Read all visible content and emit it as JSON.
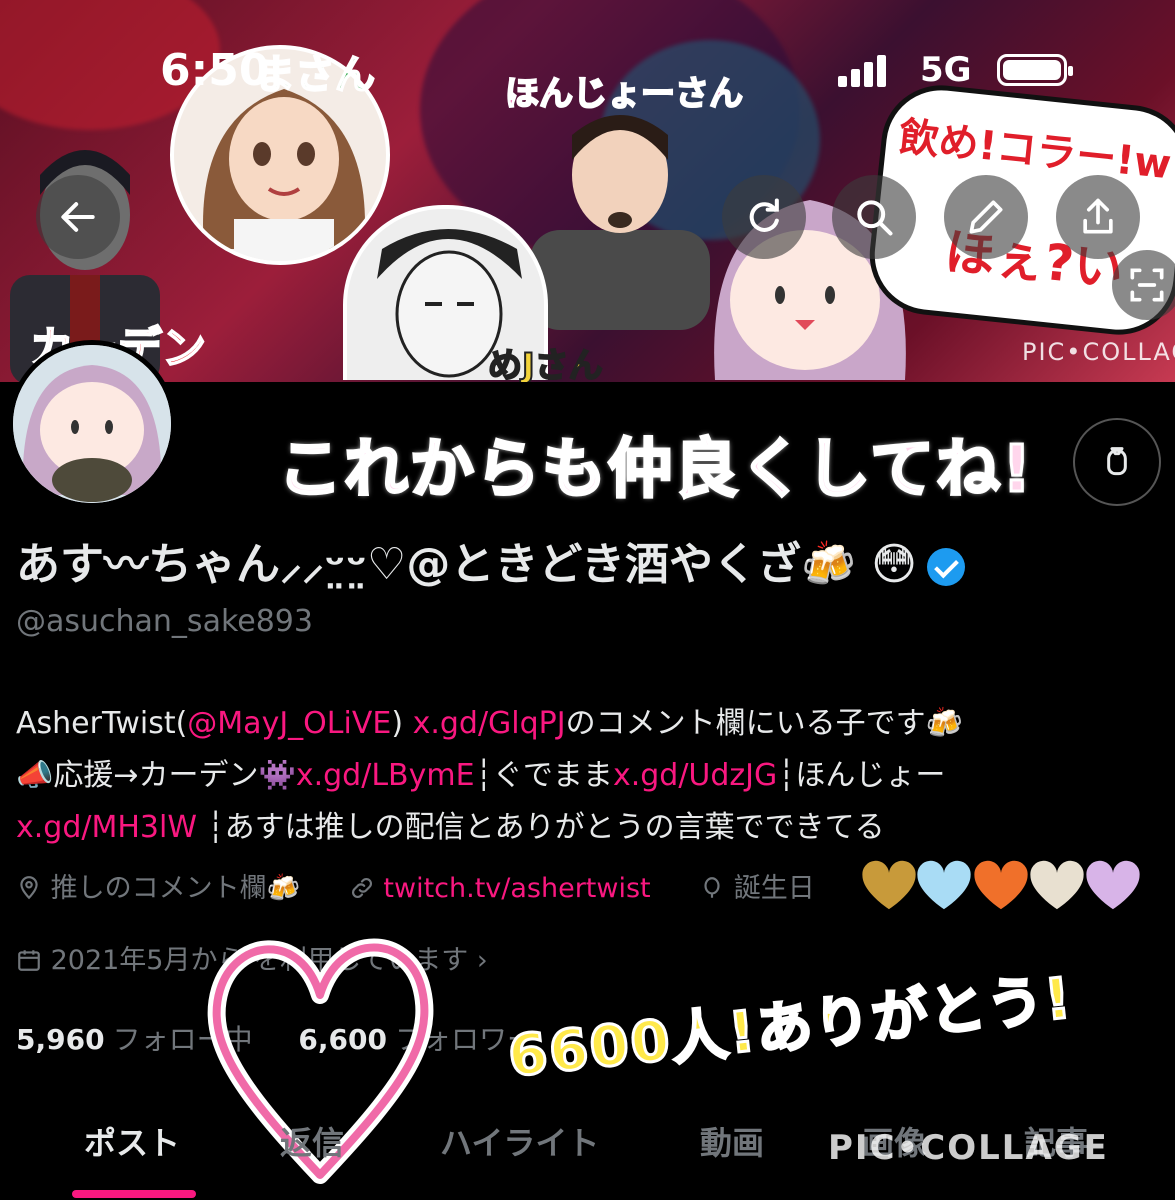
{
  "status_bar": {
    "time": "6:50",
    "network": "5G"
  },
  "banner": {
    "labels": {
      "top_left": "まさん",
      "top_center": "ほんじょーさん",
      "bottom_left": "カーデン",
      "bottom_center": "めJさん",
      "note_line1": "飲め!コラー!w",
      "note_line2": "ほぇ?い"
    },
    "watermark": "PIC•COLLAGE"
  },
  "header_icons": [
    "back-arrow-icon",
    "refresh-icon",
    "search-icon",
    "edit-icon",
    "share-icon",
    "scan-icon"
  ],
  "overlay": {
    "headline": "これからも仲良くしてね!",
    "thanks": "6600人!ありがとう!",
    "bottom_watermark": "PIC•COLLAGE"
  },
  "profile": {
    "display_name": "あす〰ちゃん⸝⸝ᵕ̤ᵕ̤♡@ときどき酒やくざ🍻 😳",
    "handle": "@asuchan_sake893",
    "bio": {
      "l1_a": "AsherTwist(",
      "l1_link1": "@MayJ_OLiVE",
      "l1_b": ") ",
      "l1_link2": "x.gd/GlqPJ",
      "l1_c": "のコメント欄にいる子です🍻",
      "l2_a": "📣応援→カーデン👾",
      "l2_link1": "x.gd/LBymE",
      "l2_b": "┆ぐでまま",
      "l2_link2": "x.gd/UdzJG",
      "l2_c": "┆ほんじょー",
      "l3_link": "x.gd/MH3lW",
      "l3_a": " ┆あすは推しの配信とありがとうの言葉でできてる"
    },
    "location": "推しのコメント欄🍻",
    "website": "twitch.tv/ashertwist",
    "birthday": "誕生日",
    "joined": "2021年5月から  を利用しています",
    "following_count": "5,960",
    "following_label": "フォロー中",
    "followers_count": "6,600",
    "followers_label": "フォロワー"
  },
  "tabs": [
    "ポスト",
    "返信",
    "ハイライト",
    "動画",
    "画像",
    "記事"
  ],
  "active_tab": 0,
  "colors": {
    "accent": "#f91880",
    "verified": "#1d9bf0",
    "background": "#000000",
    "muted": "#71767b"
  }
}
